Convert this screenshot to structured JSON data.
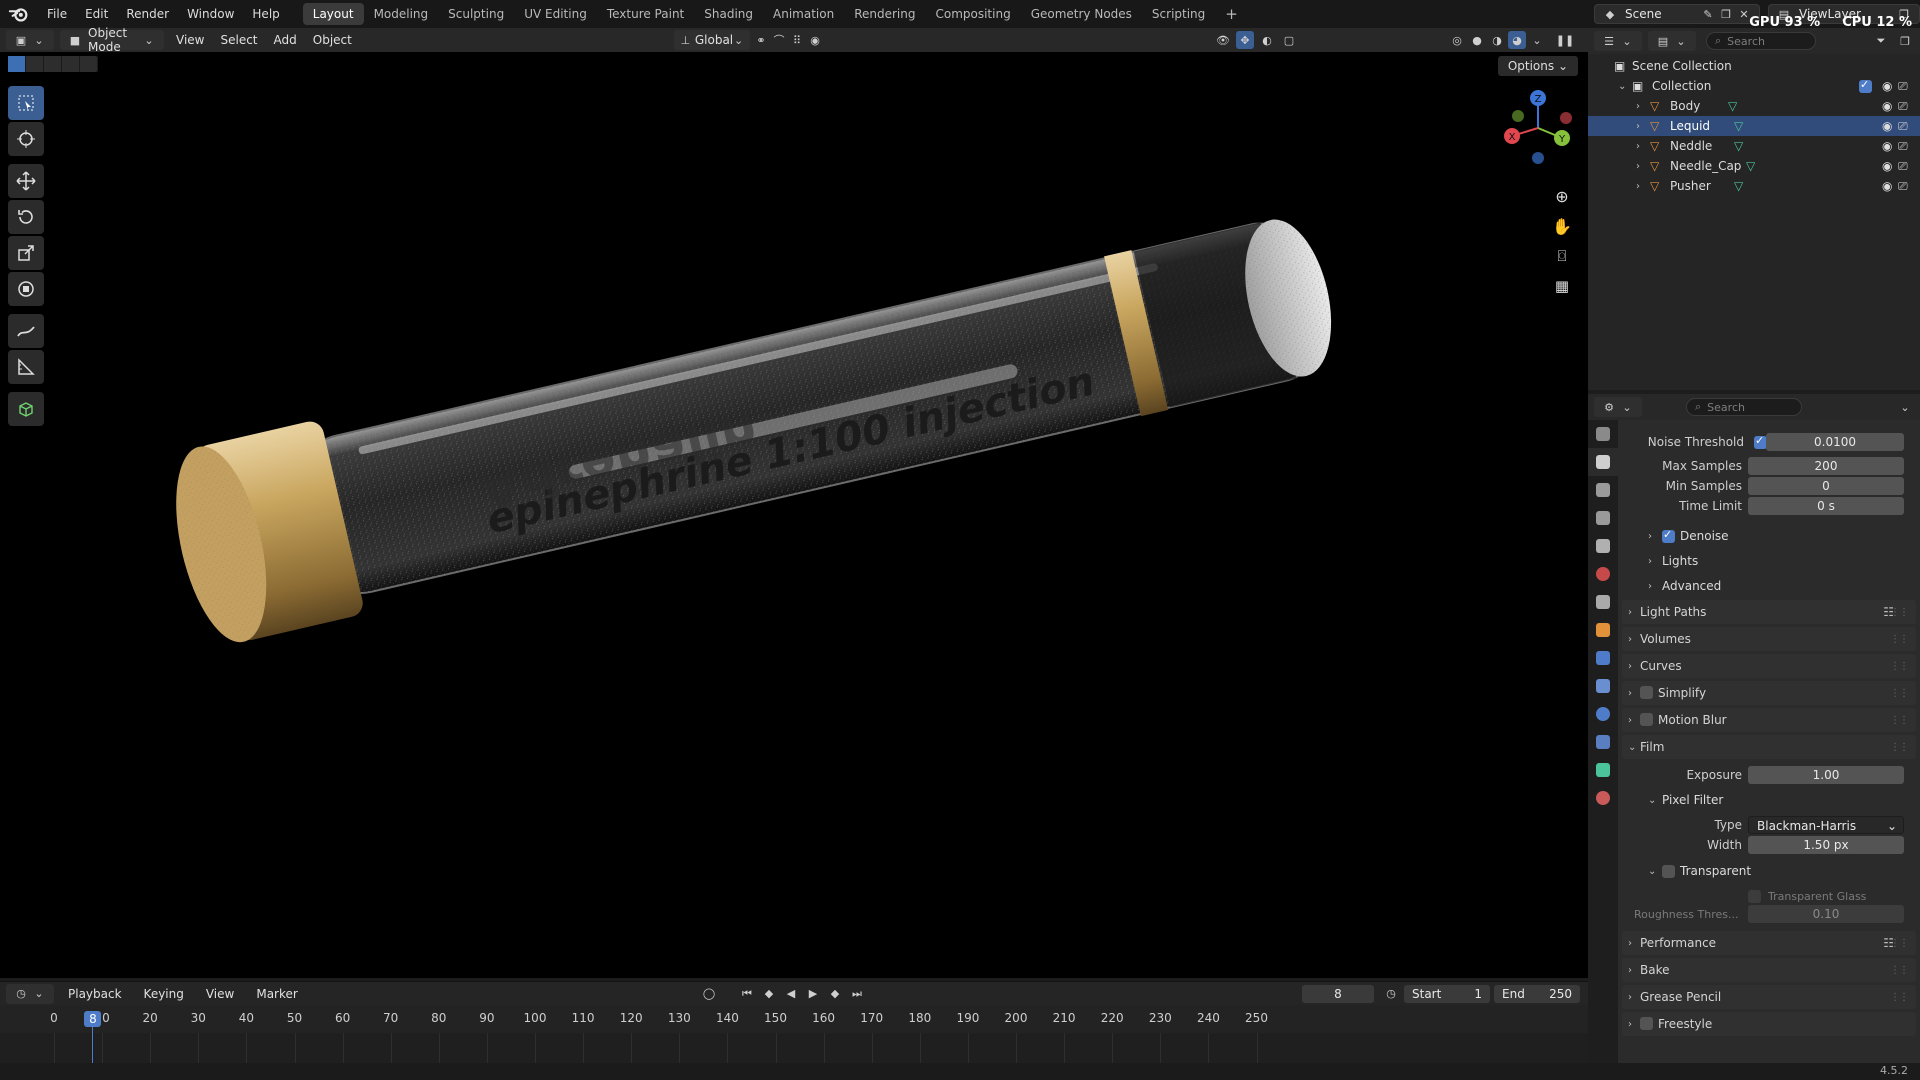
{
  "menu": {
    "items": [
      "File",
      "Edit",
      "Render",
      "Window",
      "Help"
    ],
    "workspaces": [
      "Layout",
      "Modeling",
      "Sculpting",
      "UV Editing",
      "Texture Paint",
      "Shading",
      "Animation",
      "Rendering",
      "Compositing",
      "Geometry Nodes",
      "Scripting"
    ],
    "active_workspace": "Layout",
    "add_tab": "+"
  },
  "topright": {
    "scene": "Scene",
    "view_layer": "ViewLayer",
    "gpu": "GPU 93 %",
    "cpu": "CPU 12 %"
  },
  "viewport_header": {
    "mode": "Object Mode",
    "menus": [
      "View",
      "Select",
      "Add",
      "Object"
    ],
    "transform_orientation": "Global",
    "options": "Options"
  },
  "scene_text": {
    "label": "epinephrine 1:100 injection",
    "mirrored": "Adrenalin"
  },
  "outliner": {
    "search_placeholder": "Search",
    "scene_collection": "Scene Collection",
    "collection": "Collection",
    "objects": [
      "Body",
      "Lequid",
      "Neddle",
      "Needle_Cap",
      "Pusher"
    ],
    "selected": "Lequid"
  },
  "properties": {
    "search_placeholder": "Search",
    "noise_threshold": {
      "label": "Noise Threshold",
      "value": "0.0100",
      "enabled": true
    },
    "max_samples": {
      "label": "Max Samples",
      "value": "200"
    },
    "min_samples": {
      "label": "Min Samples",
      "value": "0"
    },
    "time_limit": {
      "label": "Time Limit",
      "value": "0 s"
    },
    "denoise": {
      "label": "Denoise",
      "enabled": true
    },
    "lights": "Lights",
    "advanced": "Advanced",
    "light_paths": "Light Paths",
    "volumes": "Volumes",
    "curves": "Curves",
    "simplify": "Simplify",
    "motion_blur": "Motion Blur",
    "film": "Film",
    "exposure": {
      "label": "Exposure",
      "value": "1.00"
    },
    "pixel_filter": "Pixel Filter",
    "filter_type": {
      "label": "Type",
      "value": "Blackman-Harris"
    },
    "filter_width": {
      "label": "Width",
      "value": "1.50 px"
    },
    "transparent": "Transparent",
    "transparent_glass": "Transparent Glass",
    "roughness_threshold": {
      "label": "Roughness Thres...",
      "value": "0.10"
    },
    "performance": "Performance",
    "bake": "Bake",
    "grease_pencil": "Grease Pencil",
    "freestyle": "Freestyle"
  },
  "timeline": {
    "menus": [
      "Playback",
      "Keying",
      "View",
      "Marker"
    ],
    "current_frame": "8",
    "start_label": "Start",
    "start": "1",
    "end_label": "End",
    "end": "250",
    "ticks": [
      "0",
      "10",
      "20",
      "30",
      "40",
      "50",
      "60",
      "70",
      "80",
      "90",
      "100",
      "110",
      "120",
      "130",
      "140",
      "150",
      "160",
      "170",
      "180",
      "190",
      "200",
      "210",
      "220",
      "230",
      "240",
      "250"
    ]
  },
  "status": {
    "version": "4.5.2"
  },
  "colors": {
    "accent": "#4f7cc8",
    "selection": "#314b7a",
    "object_icon": "#e0913a",
    "mesh_data_icon": "#4cc39a",
    "cap_gold": "#c7a35f"
  }
}
